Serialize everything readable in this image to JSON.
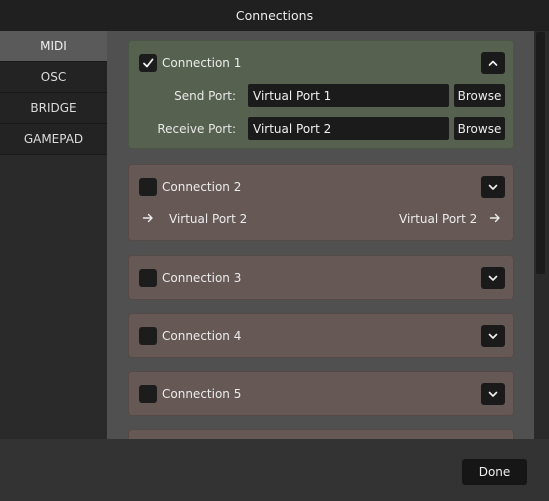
{
  "window": {
    "title": "Connections"
  },
  "sidebar": {
    "items": [
      {
        "label": "MIDI",
        "active": true
      },
      {
        "label": "OSC"
      },
      {
        "label": "BRIDGE"
      },
      {
        "label": "GAMEPAD"
      }
    ]
  },
  "connections": [
    {
      "name": "Connection 1",
      "enabled": true,
      "expanded": true,
      "send_label": "Send Port:",
      "send_value": "Virtual Port 1",
      "receive_label": "Receive Port:",
      "receive_value": "Virtual Port 2",
      "browse_label": "Browse"
    },
    {
      "name": "Connection 2",
      "enabled": false,
      "expanded": false,
      "in_port": "Virtual Port 2",
      "out_port": "Virtual Port 2"
    },
    {
      "name": "Connection 3",
      "enabled": false,
      "expanded": false
    },
    {
      "name": "Connection 4",
      "enabled": false,
      "expanded": false
    },
    {
      "name": "Connection 5",
      "enabled": false,
      "expanded": false
    }
  ],
  "footer": {
    "done_label": "Done"
  },
  "colors": {
    "card_enabled": "#56624f",
    "card_disabled": "#655855",
    "content_bg": "#505050"
  },
  "icons": {
    "check": "check-icon",
    "collapse": "chevron-up-icon",
    "expand": "chevron-down-icon",
    "route": "arrow-right-icon"
  }
}
